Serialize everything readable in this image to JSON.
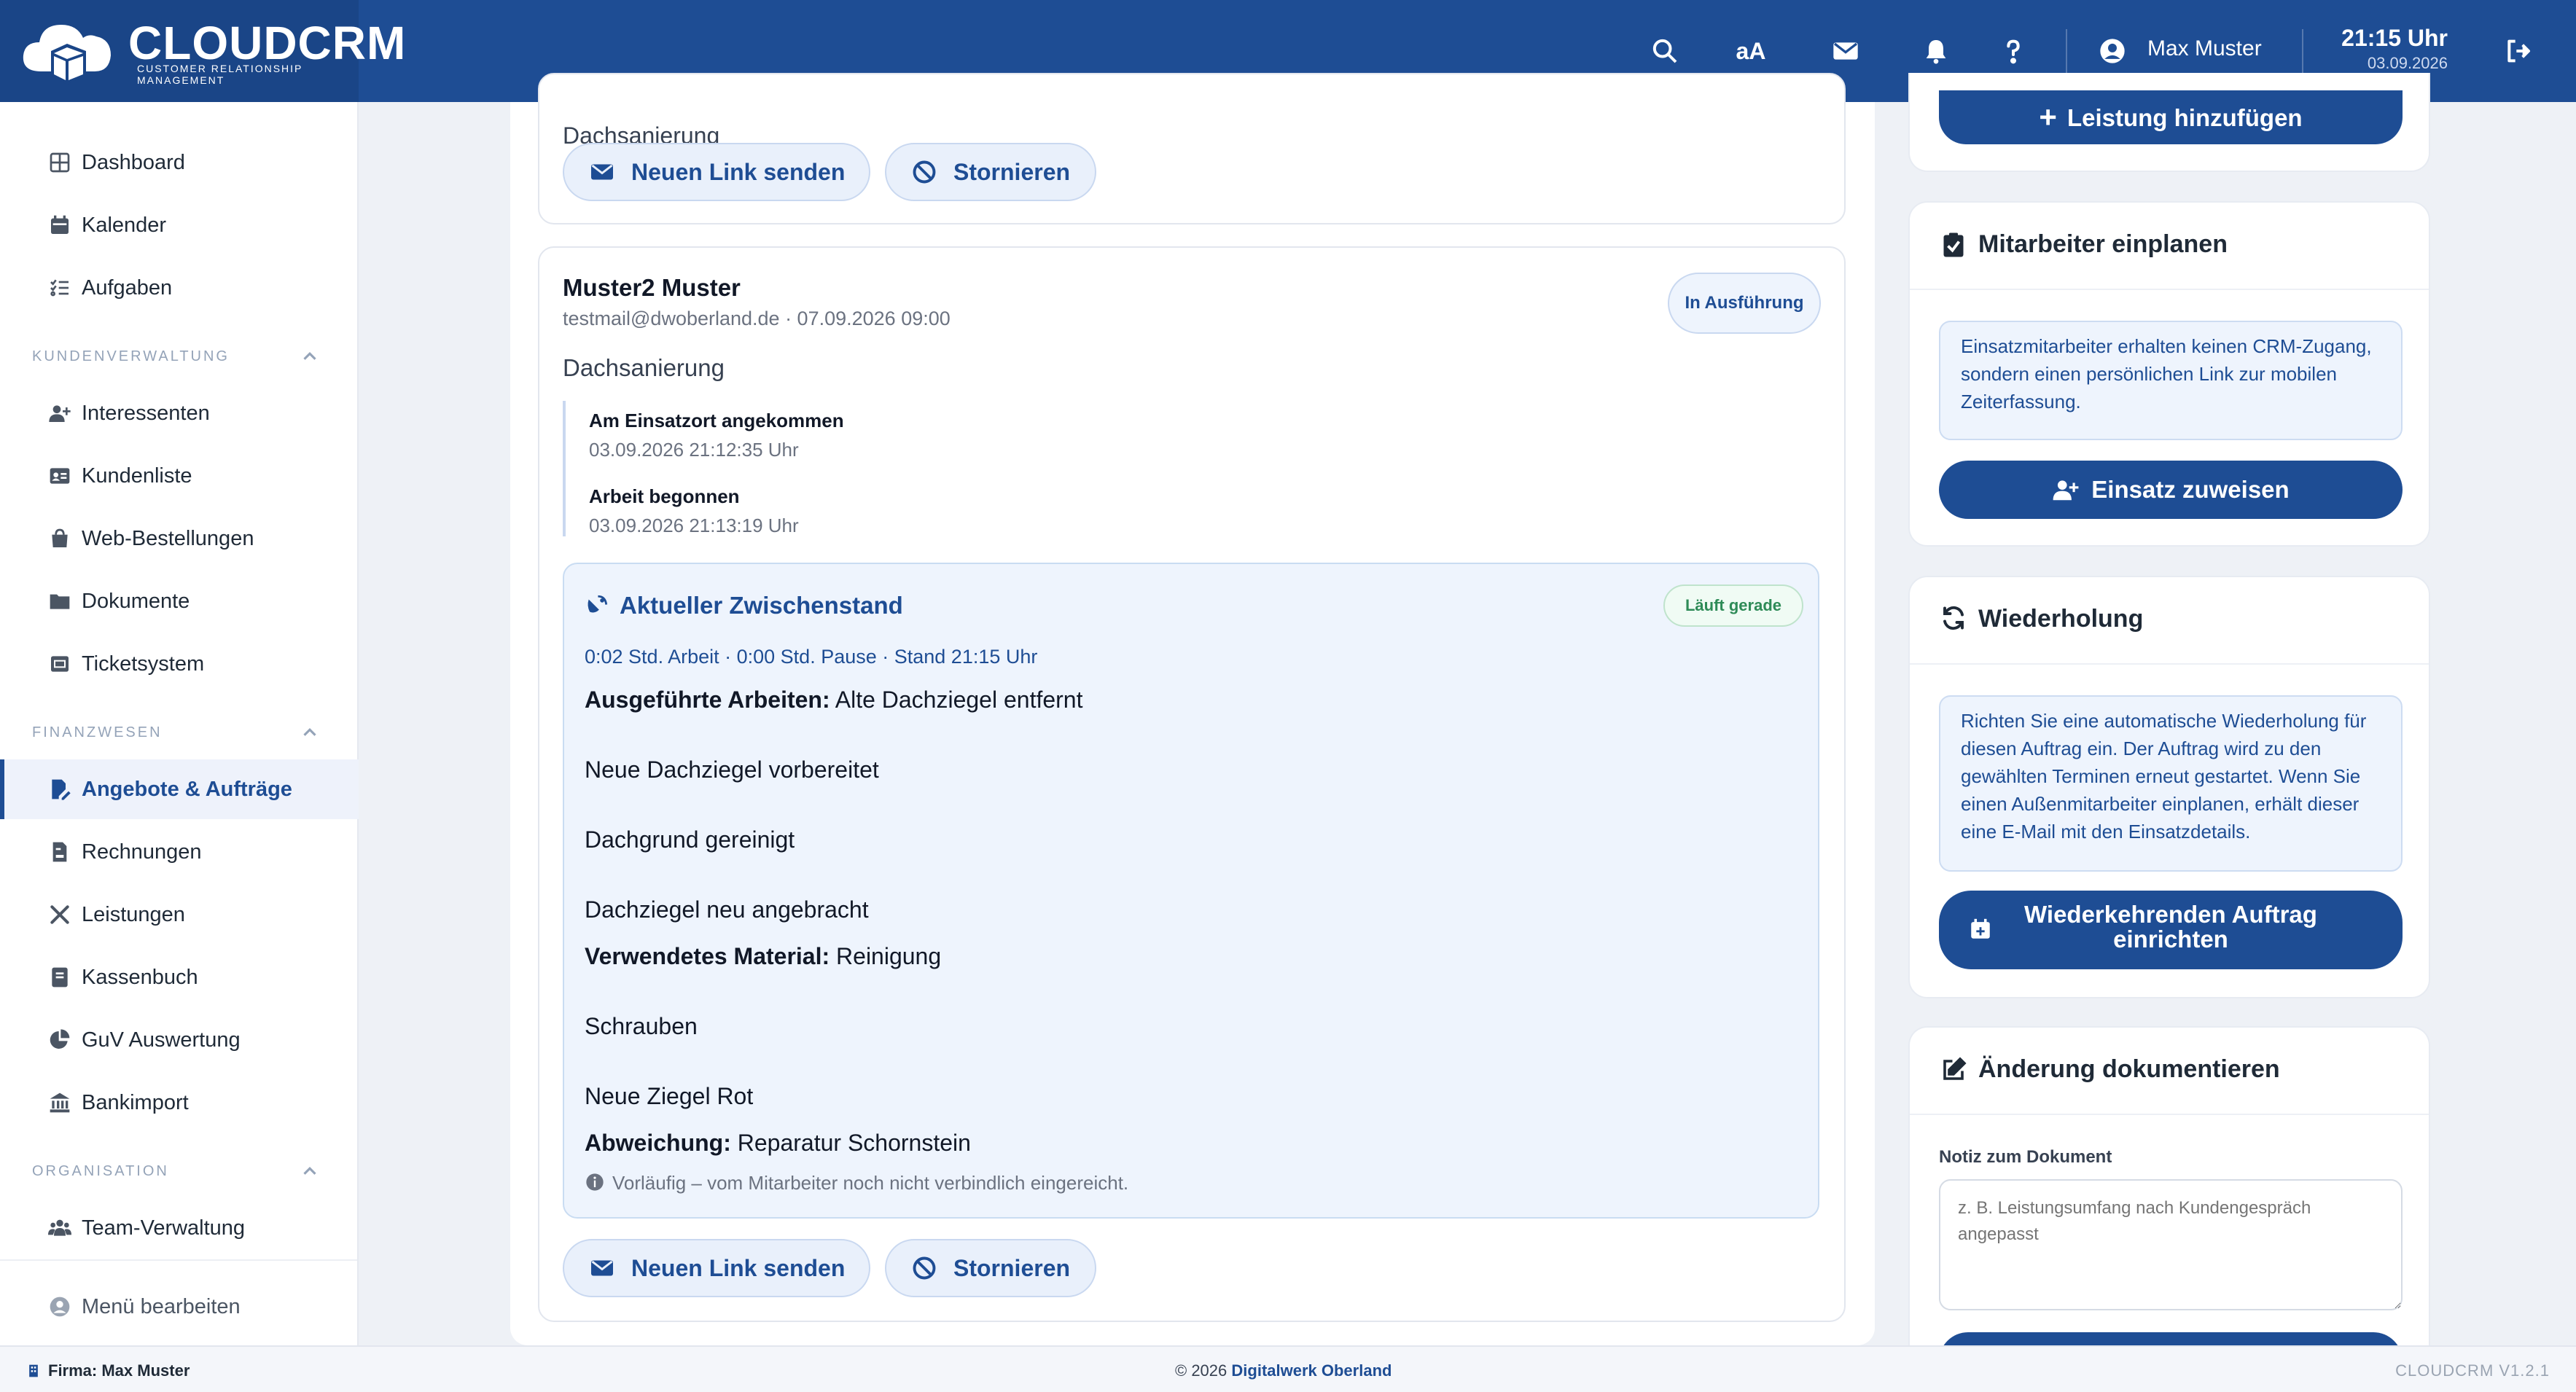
{
  "app": {
    "brand": "CLOUDCRM",
    "brand_sub": "CUSTOMER RELATIONSHIP MANAGEMENT"
  },
  "topbar": {
    "font_toggle": "aA",
    "user_name": "Max Muster",
    "time": "21:15 Uhr",
    "date": "03.09.2026",
    "icons": [
      "search-icon",
      "font-size-icon",
      "mail-icon",
      "bell-icon",
      "help-icon",
      "user-icon",
      "logout-icon"
    ]
  },
  "sidebar": {
    "items_top": [
      {
        "label": "Dashboard",
        "icon": "grid-icon"
      },
      {
        "label": "Kalender",
        "icon": "calendar-icon"
      },
      {
        "label": "Aufgaben",
        "icon": "checklist-icon"
      }
    ],
    "section1": "KUNDENVERWALTUNG",
    "items_customers": [
      {
        "label": "Interessenten",
        "icon": "user-plus-icon"
      },
      {
        "label": "Kundenliste",
        "icon": "id-card-icon"
      },
      {
        "label": "Web-Bestellungen",
        "icon": "shopping-bag-icon"
      },
      {
        "label": "Dokumente",
        "icon": "folder-icon"
      },
      {
        "label": "Ticketsystem",
        "icon": "ticket-icon"
      }
    ],
    "section2": "FINANZWESEN",
    "items_finance": [
      {
        "label": "Angebote & Aufträge",
        "icon": "file-signature-icon",
        "active": true
      },
      {
        "label": "Rechnungen",
        "icon": "invoice-icon"
      },
      {
        "label": "Leistungen",
        "icon": "tools-icon"
      },
      {
        "label": "Kassenbuch",
        "icon": "book-icon"
      },
      {
        "label": "GuV Auswertung",
        "icon": "pie-chart-icon"
      },
      {
        "label": "Bankimport",
        "icon": "bank-icon"
      }
    ],
    "section3": "ORGANISATION",
    "items_org": [
      {
        "label": "Team-Verwaltung",
        "icon": "users-icon"
      }
    ],
    "edit_menu": "Menü bearbeiten"
  },
  "job_prev": {
    "service": "Dachsanierung",
    "btn_link": "Neuen Link senden",
    "btn_cancel": "Stornieren"
  },
  "job": {
    "name": "Muster2 Muster",
    "meta": "testmail@dwoberland.de · 07.09.2026 09:00",
    "status": "In Ausführung",
    "service": "Dachsanierung",
    "timeline": [
      {
        "title": "Am Einsatzort angekommen",
        "time": "03.09.2026 21:12:35 Uhr"
      },
      {
        "title": "Arbeit begonnen",
        "time": "03.09.2026 21:13:19 Uhr"
      }
    ],
    "progress": {
      "title": "Aktueller Zwischenstand",
      "badge": "Läuft gerade",
      "stats": "0:02 Std. Arbeit · 0:00 Std. Pause · Stand 21:15 Uhr",
      "work_label": "Ausgeführte Arbeiten:",
      "work_lines": [
        "Alte Dachziegel entfernt",
        "Neue Dachziegel vorbereitet",
        "Dachgrund gereinigt",
        "Dachziegel neu angebracht"
      ],
      "material_label": "Verwendetes Material:",
      "material_lines": [
        "Reinigung",
        "Schrauben",
        "Neue Ziegel Rot"
      ],
      "deviation_label": "Abweichung:",
      "deviation": "Reparatur Schornstein",
      "note": "Vorläufig – vom Mitarbeiter noch nicht verbindlich eingereicht."
    },
    "btn_link": "Neuen Link senden",
    "btn_cancel": "Stornieren"
  },
  "right": {
    "add_service": "Leistung hinzufügen",
    "staff": {
      "title": "Mitarbeiter einplanen",
      "info": "Einsatzmitarbeiter erhalten keinen CRM-Zugang, sondern einen persönlichen Link zur mobilen Zeiterfassung.",
      "button": "Einsatz zuweisen"
    },
    "repeat": {
      "title": "Wiederholung",
      "info": "Richten Sie eine automatische Wiederholung für diesen Auftrag ein. Der Auftrag wird zu den gewählten Terminen erneut gestartet. Wenn Sie einen Außenmitarbeiter einplanen, erhält dieser eine E-Mail mit den Einsatzdetails.",
      "button_line1": "Wiederkehrenden Auftrag",
      "button_line2": "einrichten"
    },
    "doc": {
      "title": "Änderung dokumentieren",
      "label": "Notiz zum Dokument",
      "placeholder": "z. B. Leistungsumfang nach Kundengespräch angepasst"
    }
  },
  "footer": {
    "firm": "Firma: Max Muster",
    "copy_prefix": "© 2026",
    "copy_company": "Digitalwerk Oberland",
    "version": "CLOUDCRM V1.2.1"
  },
  "colors": {
    "primary": "#1e4d94",
    "accent_bg": "#eef4fd",
    "success": "#2e8b57"
  }
}
